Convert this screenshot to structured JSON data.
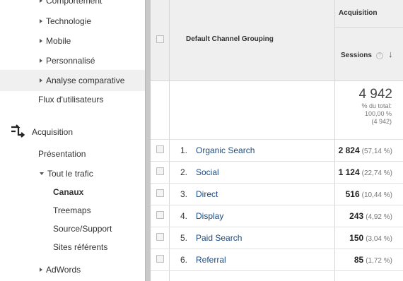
{
  "sidebar": {
    "items": [
      {
        "label": "Comportement"
      },
      {
        "label": "Technologie"
      },
      {
        "label": "Mobile"
      },
      {
        "label": "Personnalisé"
      },
      {
        "label": "Analyse comparative"
      },
      {
        "label": "Flux d'utilisateurs"
      }
    ],
    "acquisition": {
      "label": "Acquisition"
    },
    "sub": [
      {
        "label": "Présentation"
      },
      {
        "label": "Tout le trafic"
      },
      {
        "label": "Canaux"
      },
      {
        "label": "Treemaps"
      },
      {
        "label": "Source/Support"
      },
      {
        "label": "Sites référents"
      },
      {
        "label": "AdWords"
      }
    ]
  },
  "table": {
    "group_header": "Acquisition",
    "dimension_header": "Default Channel Grouping",
    "metric_header": "Sessions",
    "help_glyph": "?",
    "sort_glyph": "↓",
    "total": {
      "value": "4 942",
      "line1": "% du total:",
      "line2": "100,00 %",
      "line3": "(4 942)"
    },
    "rows": [
      {
        "index": "1.",
        "channel": "Organic Search",
        "sessions": "2 824",
        "pct": "(57,14 %)"
      },
      {
        "index": "2.",
        "channel": "Social",
        "sessions": "1 124",
        "pct": "(22,74 %)"
      },
      {
        "index": "3.",
        "channel": "Direct",
        "sessions": "516",
        "pct": "(10,44 %)"
      },
      {
        "index": "4.",
        "channel": "Display",
        "sessions": "243",
        "pct": "(4,92 %)"
      },
      {
        "index": "5.",
        "channel": "Paid Search",
        "sessions": "150",
        "pct": "(3,04 %)"
      },
      {
        "index": "6.",
        "channel": "Referral",
        "sessions": "85",
        "pct": "(1,72 %)"
      }
    ]
  },
  "icons": {
    "acquisition": "acquisition-arrows-icon",
    "expand": "caret-right-icon",
    "collapse": "caret-down-icon",
    "help": "help-icon",
    "sort": "sort-descending-icon"
  },
  "colors": {
    "link": "#1c4a80",
    "header_bg": "#efefef",
    "sidebar_highlight": "#f0f0f0"
  }
}
